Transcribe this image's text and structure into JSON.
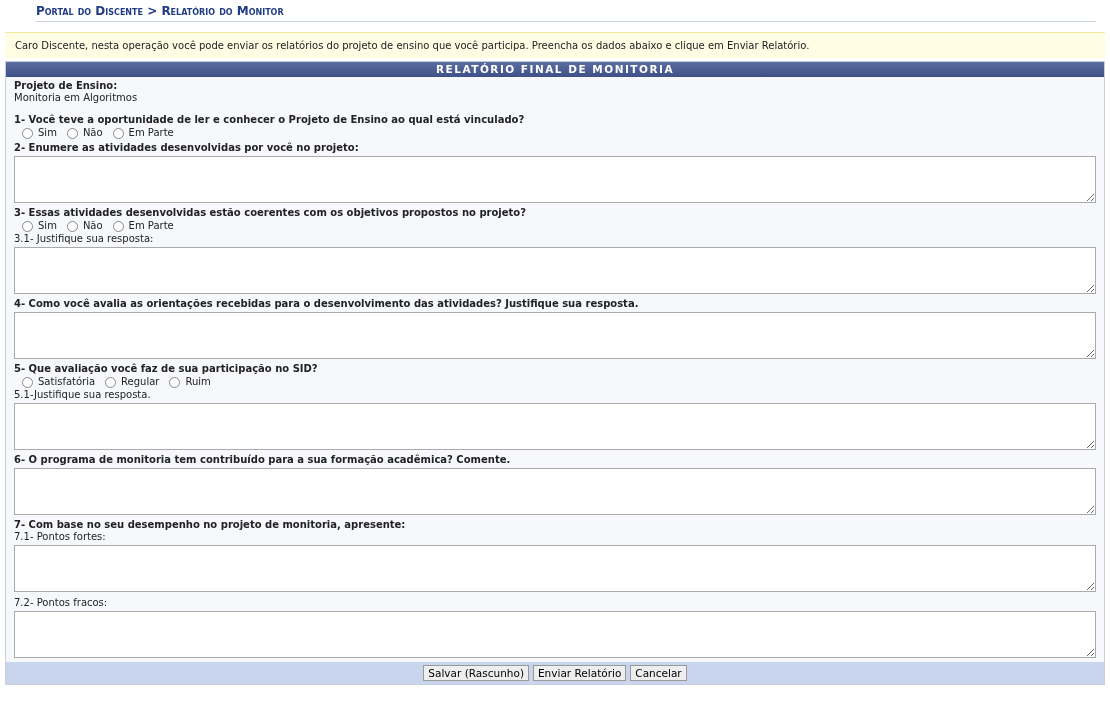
{
  "breadcrumb": "Portal do Discente > Relatório do Monitor",
  "info": "Caro Discente, nesta operação você pode enviar os relatórios do projeto de ensino que você participa. Preencha os dados abaixo e clique em Enviar Relatório.",
  "panel": {
    "title": "RELATÓRIO FINAL DE MONITORIA",
    "items": [
      {
        "kind": "question",
        "text": "Projeto de Ensino:"
      },
      {
        "kind": "value",
        "text": "Monitoria em Algoritmos"
      },
      {
        "kind": "question",
        "text": "1- Você teve a oportunidade de ler e conhecer o Projeto de Ensino ao qual está vinculado?"
      },
      {
        "kind": "options",
        "options": [
          {
            "label": "Sim",
            "selected": false
          },
          {
            "label": "Não",
            "selected": false
          },
          {
            "label": "Em Parte",
            "selected": false
          }
        ]
      },
      {
        "kind": "question",
        "text": "2- Enumere as atividades desenvolvidas por você no projeto:"
      },
      {
        "kind": "textarea"
      },
      {
        "kind": "question",
        "text": "3- Essas atividades desenvolvidas estão coerentes com os objetivos propostos no projeto?"
      },
      {
        "kind": "options",
        "options": [
          {
            "label": "Sim",
            "selected": false
          },
          {
            "label": "Não",
            "selected": false
          },
          {
            "label": "Em Parte",
            "selected": false
          }
        ]
      },
      {
        "kind": "sublabel",
        "text": "3.1- Justifique sua resposta:"
      },
      {
        "kind": "textarea"
      },
      {
        "kind": "question",
        "text": "4- Como você avalia as orientações recebidas para o desenvolvimento das atividades? Justifique sua resposta."
      },
      {
        "kind": "textarea"
      },
      {
        "kind": "question",
        "text": "5- Que avaliação você faz de sua participação no SID?"
      },
      {
        "kind": "options",
        "options": [
          {
            "label": "Satisfatória",
            "selected": false
          },
          {
            "label": "Regular",
            "selected": false
          },
          {
            "label": "Ruim",
            "selected": false
          }
        ]
      },
      {
        "kind": "sublabel",
        "text": "5.1-Justifique sua resposta."
      },
      {
        "kind": "textarea"
      },
      {
        "kind": "question",
        "text": "6- O programa de monitoria tem contribuído para a sua formação acadêmica? Comente."
      },
      {
        "kind": "textarea"
      },
      {
        "kind": "question",
        "text": "7- Com base no seu desempenho no projeto de monitoria, apresente:"
      },
      {
        "kind": "sublabel",
        "text": "7.1- Pontos fortes:"
      },
      {
        "kind": "textarea"
      },
      {
        "kind": "sublabel",
        "text": "7.2- Pontos fracos:"
      },
      {
        "kind": "textarea"
      }
    ]
  },
  "buttons": [
    "Salvar (Rascunho)",
    "Enviar Relatório",
    "Cancelar"
  ]
}
